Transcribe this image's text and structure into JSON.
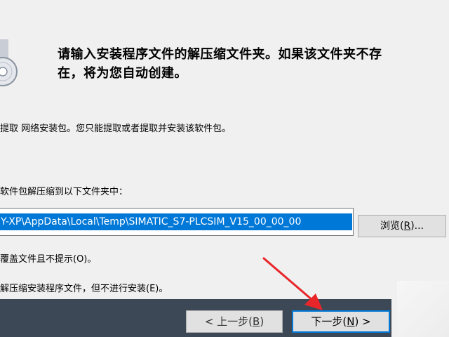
{
  "heading": {
    "line1": "请输入安装程序文件的解压缩文件夹。如果该文件夹不存",
    "line2": "在，将为您自动创建。"
  },
  "description": "提取 网络安装包。您只能提取或者提取并安装该软件包。",
  "destination_label": "软件包解压缩到以下文件夹中：",
  "path_field": {
    "value": "Y-XP\\AppData\\Local\\Temp\\SIMATIC_S7-PLCSIM_V15_00_00_00"
  },
  "browse_button": {
    "label": "浏览(",
    "hotkey": "R",
    "suffix": ")..."
  },
  "options": {
    "overwrite": "覆盖文件且不提示(O)。",
    "extract_only": "解压缩安装程序文件，但不进行安装(E)。"
  },
  "buttons": {
    "back": {
      "label": "< 上一步(",
      "hotkey": "B",
      "suffix": ")"
    },
    "next": {
      "label": "下一步(",
      "hotkey": "N",
      "suffix": ") >"
    }
  },
  "colors": {
    "selection": "#0078d7",
    "footer": "#3d4856",
    "arrow": "#e8262a"
  },
  "icons": {
    "installer": "disc-icon",
    "annotation": "red-arrow"
  }
}
